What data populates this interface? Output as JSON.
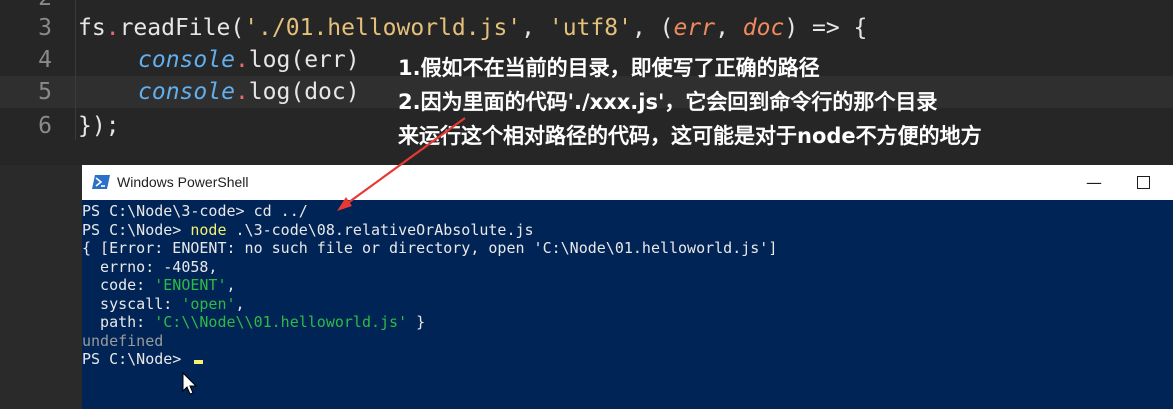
{
  "editor": {
    "lines": [
      {
        "num": "2"
      },
      {
        "num": "3"
      },
      {
        "num": "4"
      },
      {
        "num": "5"
      },
      {
        "num": "6"
      }
    ],
    "code": {
      "l3": {
        "fs": "fs",
        "dot": ".",
        "fn": "readFile",
        "open": "(",
        "str1": "'./01.helloworld.js'",
        "comma1": ", ",
        "str2": "'utf8'",
        "comma2": ", ",
        "paren_open": "(",
        "p1": "err",
        "sep": ", ",
        "p2": "doc",
        "paren_close": ")",
        "arrow": " => {"
      },
      "l4": {
        "obj": "console",
        "dot": ".",
        "fn": "log",
        "args": "(err)"
      },
      "l5": {
        "obj": "console",
        "dot": ".",
        "fn": "log",
        "args": "(doc)"
      },
      "l6": {
        "text": "});"
      }
    },
    "annotations": [
      "1.假如不在当前的目录，即使写了正确的路径",
      "2.因为里面的代码'./xxx.js'，它会回到命令行的那个目录",
      "来运行这个相对路径的代码，这可能是对于node不方便的地方"
    ]
  },
  "powershell": {
    "title": "Windows PowerShell",
    "minimize": "—",
    "lines": {
      "l1_prompt": "PS C:\\Node\\3-code> ",
      "l1_cmd": "cd ../",
      "l2_prompt": "PS C:\\Node> ",
      "l2_cmd": "node",
      "l2_arg": " .\\3-code\\08.relativeOrAbsolute.js",
      "l3": "{ [Error: ENOENT: no such file or directory, open 'C:\\Node\\01.helloworld.js']",
      "l4": "  errno: -4058,",
      "l5_key": "  code: ",
      "l5_val": "'ENOENT'",
      "l5_end": ",",
      "l6_key": "  syscall: ",
      "l6_val": "'open'",
      "l6_end": ",",
      "l7_key": "  path: ",
      "l7_val": "'C:\\\\Node\\\\01.helloworld.js'",
      "l7_end": " }",
      "l8": "undefined",
      "l9_prompt": "PS C:\\Node> "
    }
  },
  "colors": {
    "editor_bg": "#262626",
    "ps_bg": "#012456",
    "annotation_arrow": "#e53935"
  }
}
